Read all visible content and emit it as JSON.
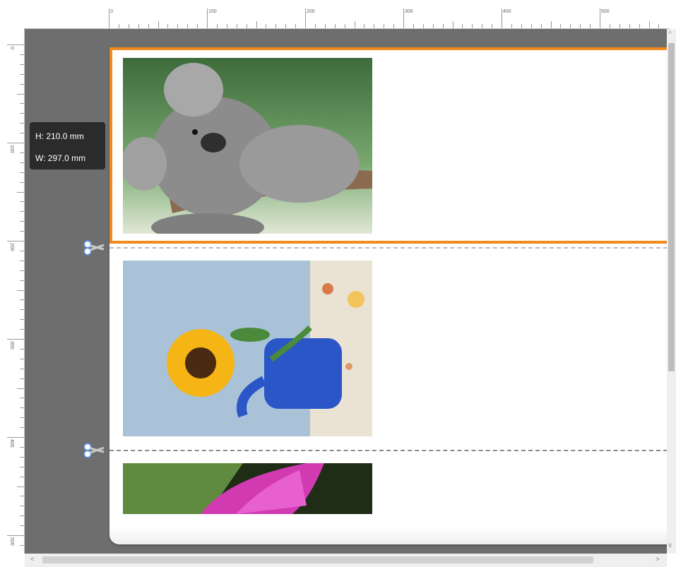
{
  "rulers": {
    "top_labels": [
      "0",
      "100",
      "200",
      "300",
      "400",
      "500"
    ],
    "left_labels": [
      "0",
      "100",
      "200",
      "300",
      "400",
      "500"
    ]
  },
  "tooltip": {
    "height_text": "H: 210.0 mm",
    "width_text": "W: 297.0 mm"
  },
  "pages": [
    {
      "name": "koala-photo",
      "selected": true
    },
    {
      "name": "sunflower-photo",
      "selected": false
    },
    {
      "name": "bougainvillea-photo",
      "selected": false
    }
  ],
  "icons": {
    "cut": "scissors-icon",
    "scroll_up": "chevron-up-icon",
    "scroll_down": "chevron-down-icon",
    "scroll_left": "chevron-left-icon",
    "scroll_right": "chevron-right-icon"
  },
  "colors": {
    "selection": "#f08a1d",
    "workspace": "#6e6e6e",
    "tooltip_bg": "#2b2b2b"
  },
  "scroll_glyphs": {
    "up": "^",
    "down": "v",
    "left": "<",
    "right": ">"
  }
}
